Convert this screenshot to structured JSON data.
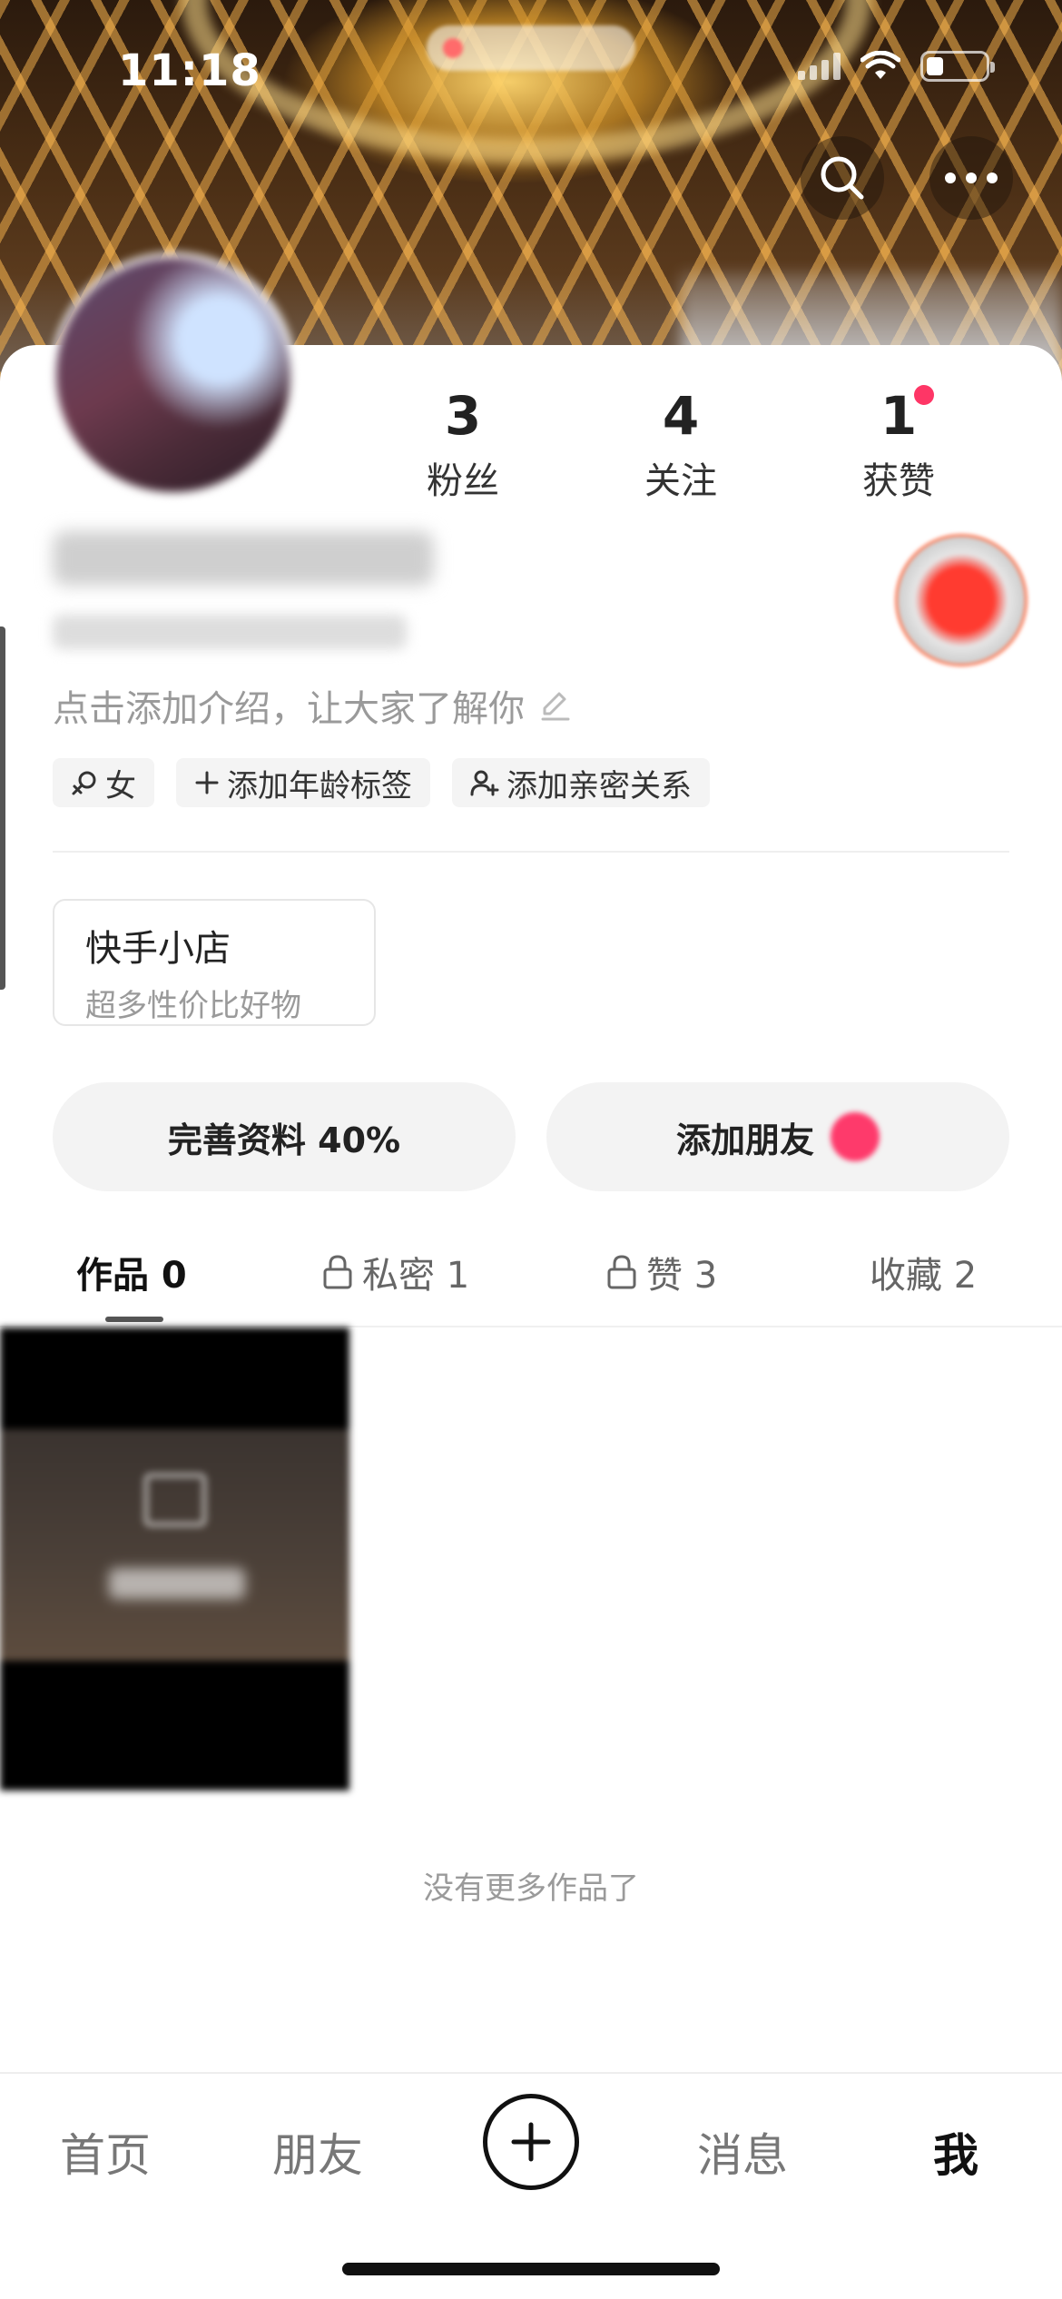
{
  "status_bar": {
    "time": "11:18"
  },
  "header": {
    "search_icon": "search-icon",
    "more_icon": "more-icon"
  },
  "profile": {
    "stats": [
      {
        "value": "3",
        "label": "粉丝"
      },
      {
        "value": "4",
        "label": "关注"
      },
      {
        "value": "1",
        "label": "获赞"
      }
    ],
    "intro": "点击添加介绍，让大家了解你",
    "tags": [
      {
        "icon": "female-icon",
        "label": "女"
      },
      {
        "icon": "plus-icon",
        "label": "添加年龄标签"
      },
      {
        "icon": "add-person-icon",
        "label": "添加亲密关系"
      }
    ]
  },
  "shop": {
    "title": "快手小店",
    "subtitle": "超多性价比好物"
  },
  "actions": {
    "complete_profile": "完善资料 40%",
    "add_friends": "添加朋友"
  },
  "tabs": [
    {
      "label": "作品 0",
      "locked": false
    },
    {
      "label": "私密 1",
      "locked": true
    },
    {
      "label": "赞 3",
      "locked": true
    },
    {
      "label": "收藏 2",
      "locked": false
    }
  ],
  "content": {
    "end_text": "没有更多作品了"
  },
  "bottom_nav": {
    "items": [
      "首页",
      "朋友",
      "消息",
      "我"
    ],
    "add_icon": "plus-circle-icon"
  },
  "colors": {
    "accent_red": "#fe3666",
    "text_primary": "#222222",
    "text_secondary": "#9a9a9a"
  }
}
